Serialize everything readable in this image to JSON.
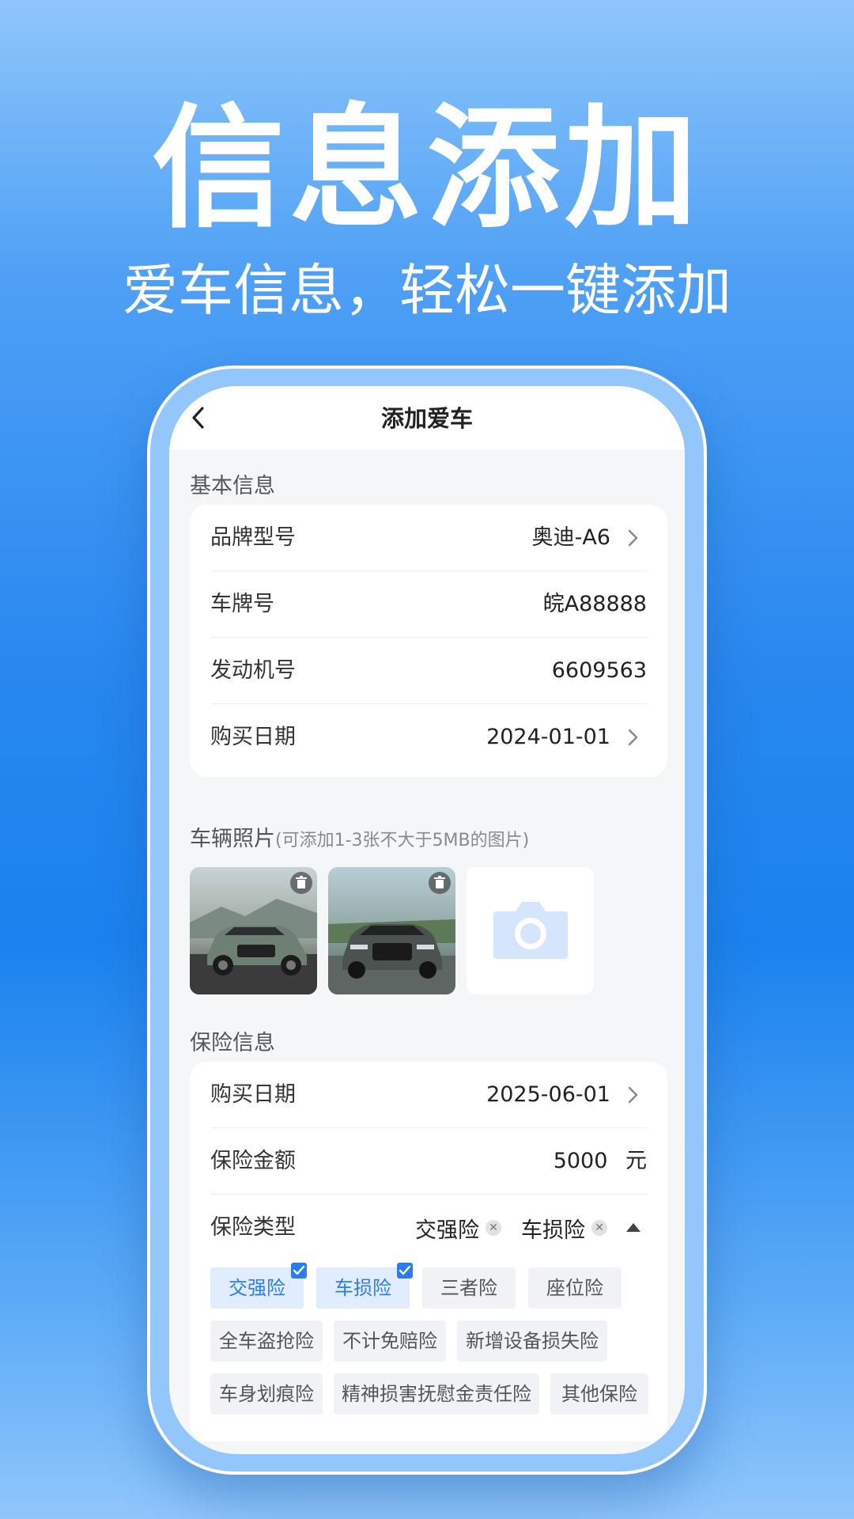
{
  "hero": {
    "title": "信息添加",
    "subtitle": "爱车信息，轻松一键添加"
  },
  "navbar": {
    "back_icon": "chevron-left-icon",
    "title": "添加爱车"
  },
  "basic_info": {
    "section_label": "基本信息",
    "rows": [
      {
        "label": "品牌型号",
        "value": "奥迪-A6",
        "has_arrow": true
      },
      {
        "label": "车牌号",
        "value": "皖A88888",
        "has_arrow": false
      },
      {
        "label": "发动机号",
        "value": "6609563",
        "has_arrow": false
      },
      {
        "label": "购买日期",
        "value": "2024-01-01",
        "has_arrow": true
      }
    ]
  },
  "photos": {
    "section_label": "车辆照片",
    "hint": "(可添加1-3张不大于5MB的图片)",
    "items": [
      {
        "kind": "photo",
        "icon": "trash-icon"
      },
      {
        "kind": "photo",
        "icon": "trash-icon"
      },
      {
        "kind": "add",
        "icon": "camera-icon"
      }
    ]
  },
  "insurance": {
    "section_label": "保险信息",
    "rows": [
      {
        "label": "购买日期",
        "value": "2025-06-01",
        "has_arrow": true
      },
      {
        "label": "保险金额",
        "value": "5000",
        "unit": "元"
      },
      {
        "label": "保险类型"
      }
    ],
    "selected_tags": [
      "交强险",
      "车损险"
    ],
    "options": [
      {
        "label": "交强险",
        "selected": true
      },
      {
        "label": "车损险",
        "selected": true
      },
      {
        "label": "三者险",
        "selected": false
      },
      {
        "label": "座位险",
        "selected": false
      },
      {
        "label": "全车盗抢险",
        "selected": false
      },
      {
        "label": "不计免赔险",
        "selected": false
      },
      {
        "label": "新增设备损失险",
        "selected": false
      },
      {
        "label": "车身划痕险",
        "selected": false
      },
      {
        "label": "精神损害抚慰金责任险",
        "selected": false
      },
      {
        "label": "其他保险",
        "selected": false
      }
    ]
  },
  "colors": {
    "accent": "#2a7df0",
    "background_top": "#8ec6fb",
    "background_mid": "#1a82ee"
  }
}
